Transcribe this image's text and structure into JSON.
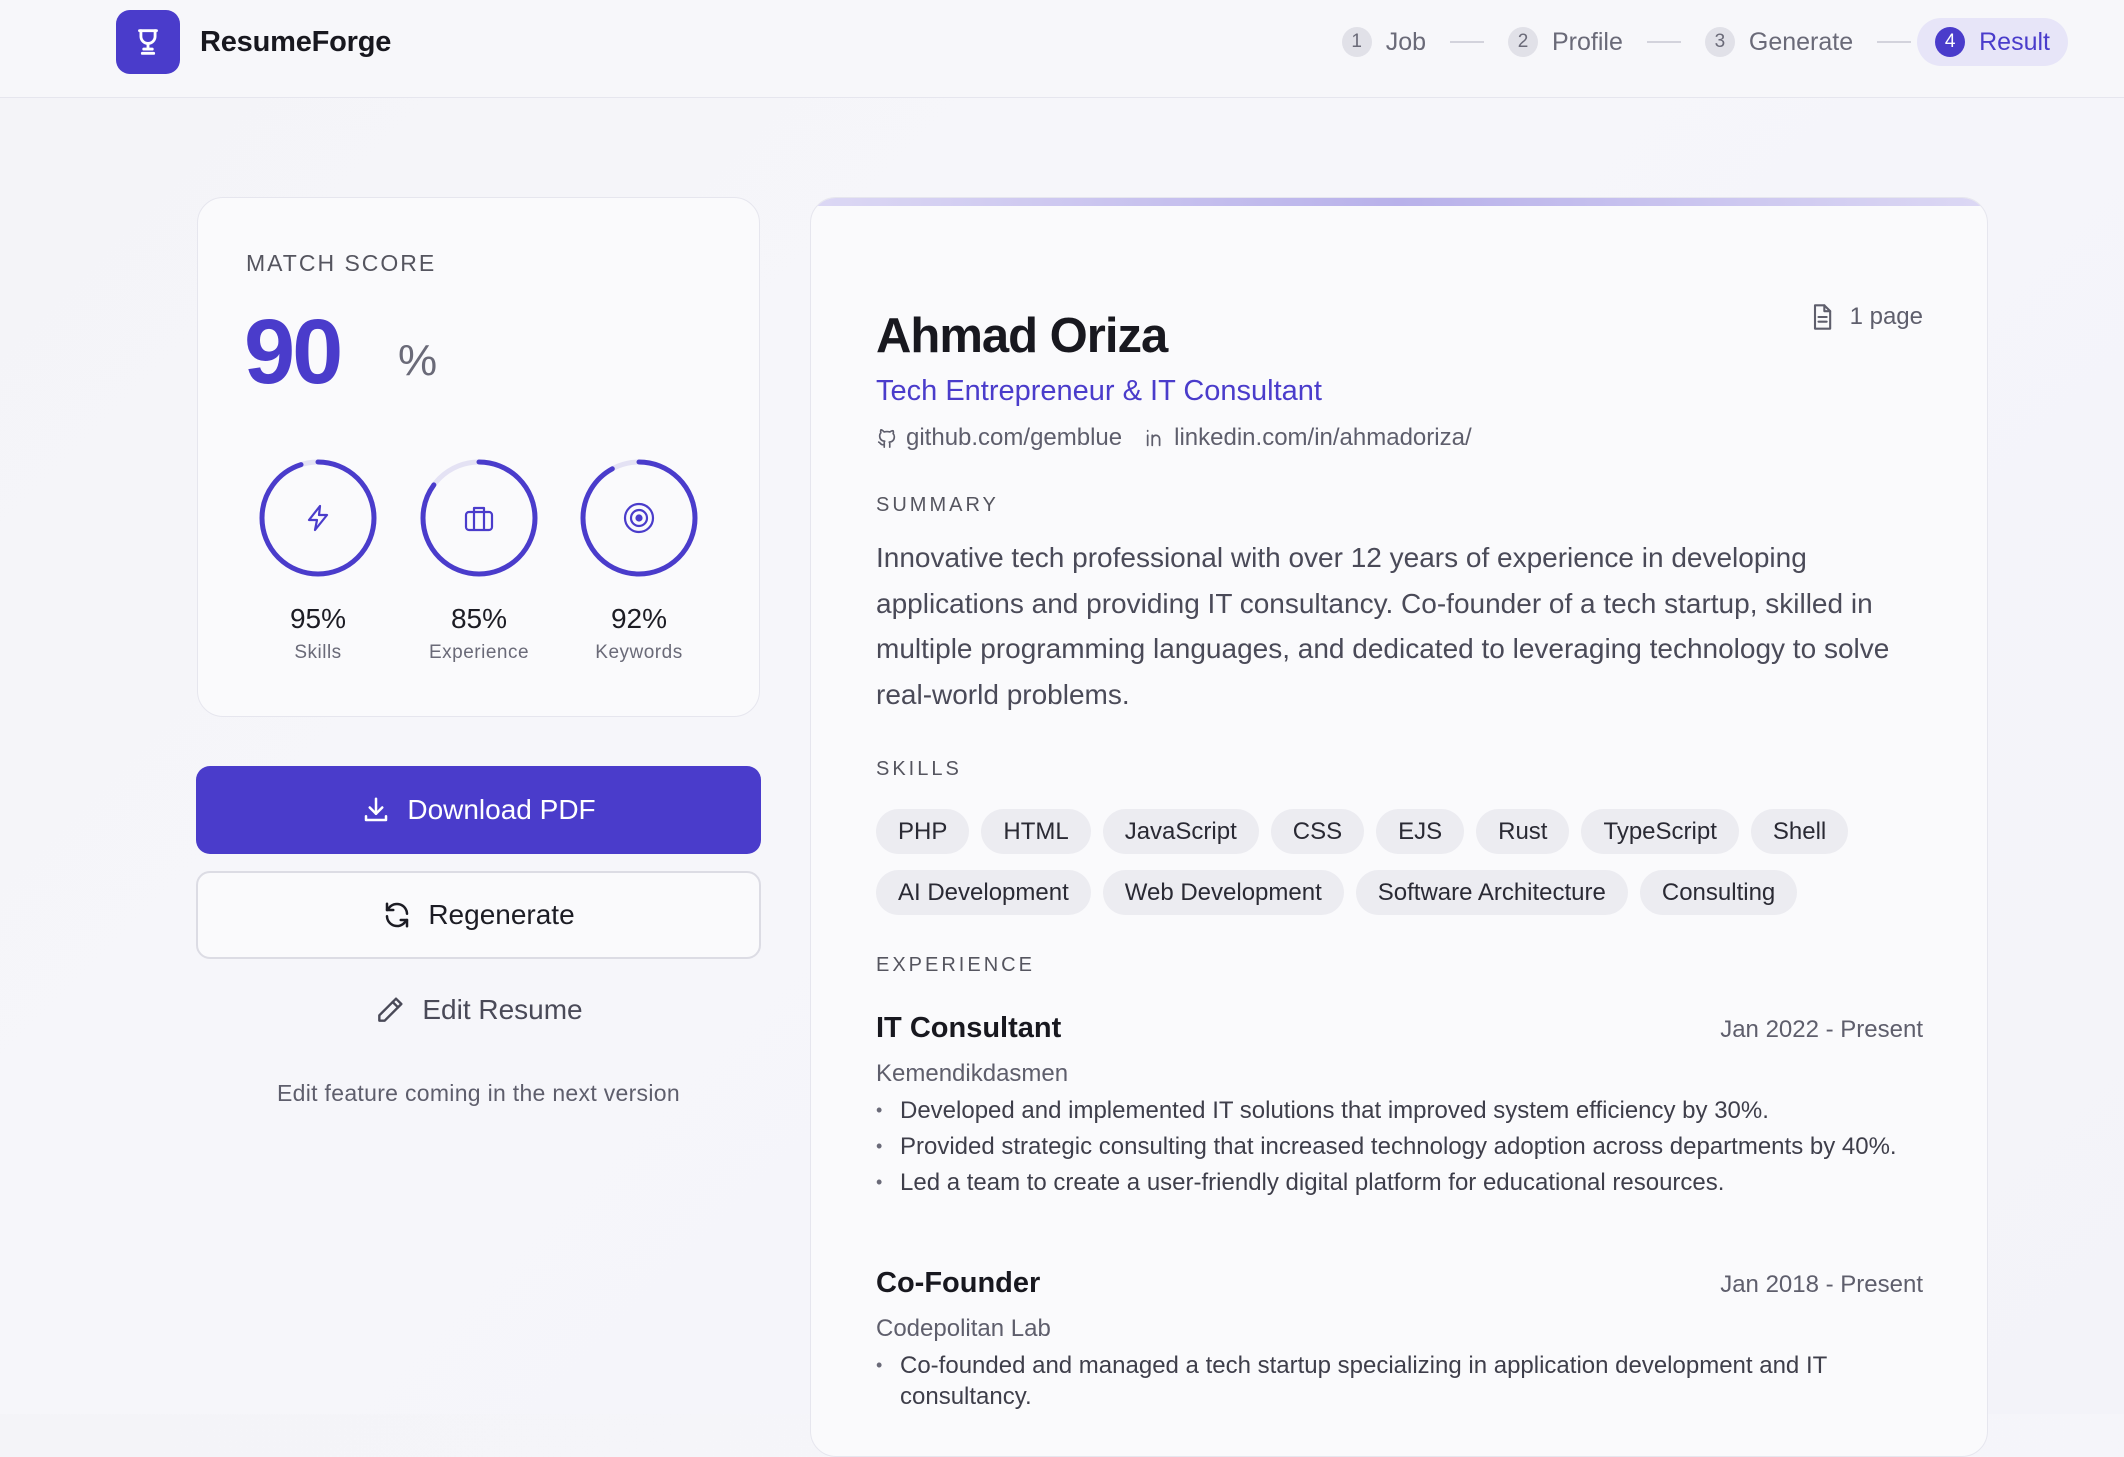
{
  "app": {
    "brand": "ResumeForge"
  },
  "steps": [
    {
      "num": "1",
      "label": "Job"
    },
    {
      "num": "2",
      "label": "Profile"
    },
    {
      "num": "3",
      "label": "Generate"
    },
    {
      "num": "4",
      "label": "Result",
      "active": true
    }
  ],
  "score": {
    "title": "MATCH SCORE",
    "value": "90",
    "unit": "%",
    "metrics": [
      {
        "pct": "95%",
        "label": "Skills",
        "icon": "lightning-icon",
        "fraction": 0.95
      },
      {
        "pct": "85%",
        "label": "Experience",
        "icon": "briefcase-icon",
        "fraction": 0.85
      },
      {
        "pct": "92%",
        "label": "Keywords",
        "icon": "target-icon",
        "fraction": 0.92
      }
    ]
  },
  "actions": {
    "download": "Download PDF",
    "regenerate": "Regenerate",
    "edit": "Edit Resume",
    "edit_note": "Edit feature coming in the next version"
  },
  "resume": {
    "name": "Ahmad Oriza",
    "pages": "1 page",
    "title": "Tech Entrepreneur & IT Consultant",
    "github": "github.com/gemblue",
    "linkedin": "linkedin.com/in/ahmadoriza/",
    "summary_heading": "SUMMARY",
    "summary": "Innovative tech professional with over 12 years of experience in developing applications and providing IT consultancy. Co-founder of a tech startup, skilled in multiple programming languages, and dedicated to leveraging technology to solve real-world problems.",
    "skills_heading": "SKILLS",
    "skills": [
      "PHP",
      "HTML",
      "JavaScript",
      "CSS",
      "EJS",
      "Rust",
      "TypeScript",
      "Shell",
      "AI Development",
      "Web Development",
      "Software Architecture",
      "Consulting"
    ],
    "experience_heading": "EXPERIENCE",
    "experience": [
      {
        "title": "IT Consultant",
        "date": "Jan 2022 - Present",
        "company": "Kemendikdasmen",
        "bullets": [
          "Developed and implemented IT solutions that improved system efficiency by 30%.",
          "Provided strategic consulting that increased technology adoption across departments by 40%.",
          "Led a team to create a user-friendly digital platform for educational resources."
        ]
      },
      {
        "title": "Co-Founder",
        "date": "Jan 2018 - Present",
        "company": "Codepolitan Lab",
        "bullets": [
          "Co-founded and managed a tech startup specializing in application development and IT consultancy."
        ]
      }
    ]
  },
  "colors": {
    "accent": "#4a3ccb",
    "chip": "#ececf1"
  }
}
